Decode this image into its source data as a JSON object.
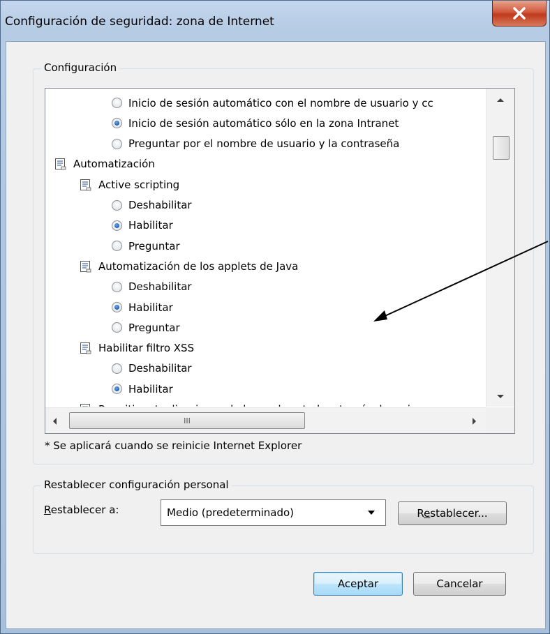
{
  "window": {
    "title": "Configuración de seguridad: zona de Internet"
  },
  "settings_group": {
    "legend": "Configuración",
    "tree": [
      {
        "kind": "radio",
        "level": 2,
        "label": "Inicio de sesión automático con el nombre de usuario y cc",
        "checked": false
      },
      {
        "kind": "radio",
        "level": 2,
        "label": "Inicio de sesión automático sólo en la zona Intranet",
        "checked": true
      },
      {
        "kind": "radio",
        "level": 2,
        "label": "Preguntar por el nombre de usuario y la contraseña",
        "checked": false
      },
      {
        "kind": "node",
        "level": 0,
        "label": "Automatización"
      },
      {
        "kind": "node",
        "level": 1,
        "label": "Active scripting"
      },
      {
        "kind": "radio",
        "level": 2,
        "label": "Deshabilitar",
        "checked": false
      },
      {
        "kind": "radio",
        "level": 2,
        "label": "Habilitar",
        "checked": true
      },
      {
        "kind": "radio",
        "level": 2,
        "label": "Preguntar",
        "checked": false
      },
      {
        "kind": "node",
        "level": 1,
        "label": "Automatización de los applets de Java"
      },
      {
        "kind": "radio",
        "level": 2,
        "label": "Deshabilitar",
        "checked": false
      },
      {
        "kind": "radio",
        "level": 2,
        "label": "Habilitar",
        "checked": true
      },
      {
        "kind": "radio",
        "level": 2,
        "label": "Preguntar",
        "checked": false
      },
      {
        "kind": "node",
        "level": 1,
        "label": "Habilitar filtro XSS"
      },
      {
        "kind": "radio",
        "level": 2,
        "label": "Deshabilitar",
        "checked": false
      },
      {
        "kind": "radio",
        "level": 2,
        "label": "Habilitar",
        "checked": true
      },
      {
        "kind": "node",
        "level": 1,
        "label": "Permitir actualizaciones de barra de estado a través de scrip"
      }
    ],
    "hscroll_thumb_glyph": "III",
    "note": "* Se aplicará cuando se reinicie Internet Explorer"
  },
  "reset_group": {
    "legend": "Restablecer configuración personal",
    "label_prefix_underlined": "R",
    "label_rest": "establecer a:",
    "select_value": "Medio (predeterminado)",
    "reset_button_underlined": "e",
    "reset_button_prefix": "R",
    "reset_button_rest": "stablecer..."
  },
  "buttons": {
    "ok": "Aceptar",
    "cancel": "Cancelar"
  },
  "icons": {
    "close": "close-x-icon",
    "settings_node": "settings-page-icon",
    "annotation": "arrow-annotation"
  },
  "colors": {
    "close_red": "#c9472a",
    "radio_checked": "#1f5fb4",
    "default_button_border": "#3c7fb1"
  }
}
